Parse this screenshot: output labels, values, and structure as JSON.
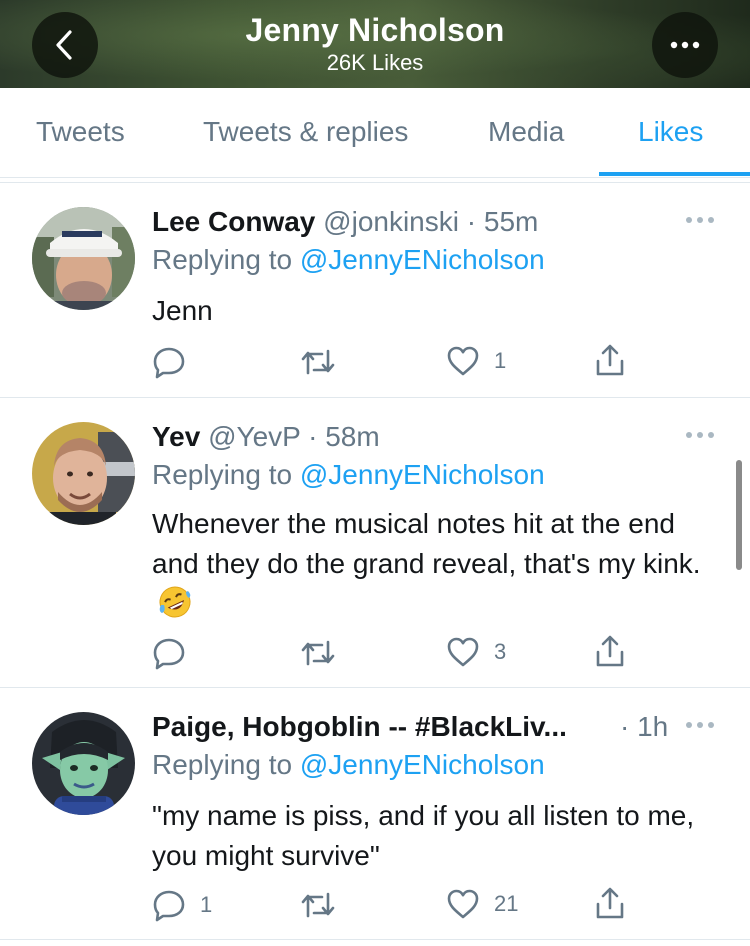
{
  "header": {
    "title": "Jenny Nicholson",
    "subtitle": "26K Likes"
  },
  "tabs": [
    {
      "label": "Tweets"
    },
    {
      "label": "Tweets & replies"
    },
    {
      "label": "Media"
    },
    {
      "label": "Likes",
      "active": true
    }
  ],
  "tweets": [
    {
      "name": "Lee Conway",
      "handle": "@jonkinski",
      "time": "· 55m",
      "replying_prefix": "Replying to ",
      "replying_to": "@JennyENicholson",
      "body": "Jenn",
      "reply_count": "",
      "retweet_count": "",
      "like_count": "1"
    },
    {
      "name": "Yev",
      "handle": "@YevP",
      "time": "· 58m",
      "replying_prefix": "Replying to ",
      "replying_to": "@JennyENicholson",
      "body": "Whenever the musical notes hit at the end and they do the grand reveal, that's my kink.",
      "emoji": "rolling-on-floor-laughing",
      "reply_count": "",
      "retweet_count": "",
      "like_count": "3"
    },
    {
      "name": "Paige, Hobgoblin -- #BlackLiv...",
      "handle": "",
      "time": "· 1h",
      "replying_prefix": "Replying to ",
      "replying_to": "@JennyENicholson",
      "body": "\"my name is piss, and if you all listen to me, you might survive\"",
      "reply_count": "1",
      "retweet_count": "",
      "like_count": "21"
    }
  ],
  "colors": {
    "accent": "#1da1f2",
    "muted": "#657786",
    "text": "#14171a"
  }
}
